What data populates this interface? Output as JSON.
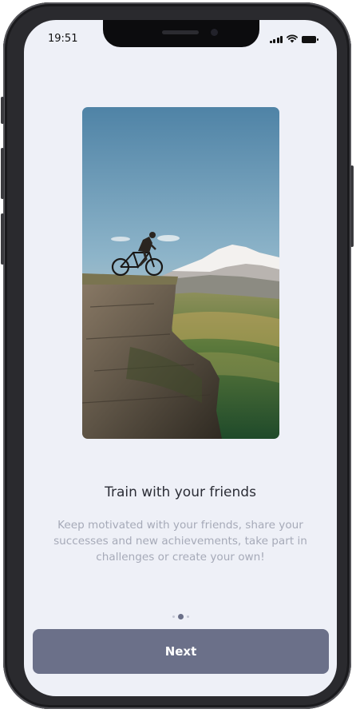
{
  "status_bar": {
    "time": "19:51",
    "icons": [
      "signal-icon",
      "wifi-icon",
      "battery-icon"
    ]
  },
  "onboarding": {
    "image": "mountain-cyclist-photo",
    "title": "Train with your friends",
    "description": "Keep motivated with your friends, share your successes and new achievements, take part in challenges or create your own!",
    "page_indicator": {
      "total": 3,
      "current": 2
    },
    "next_label": "Next"
  },
  "colors": {
    "background": "#eef0f7",
    "accent": "#6b7089",
    "title": "#2b2d36",
    "body_text": "#a6aab8"
  }
}
